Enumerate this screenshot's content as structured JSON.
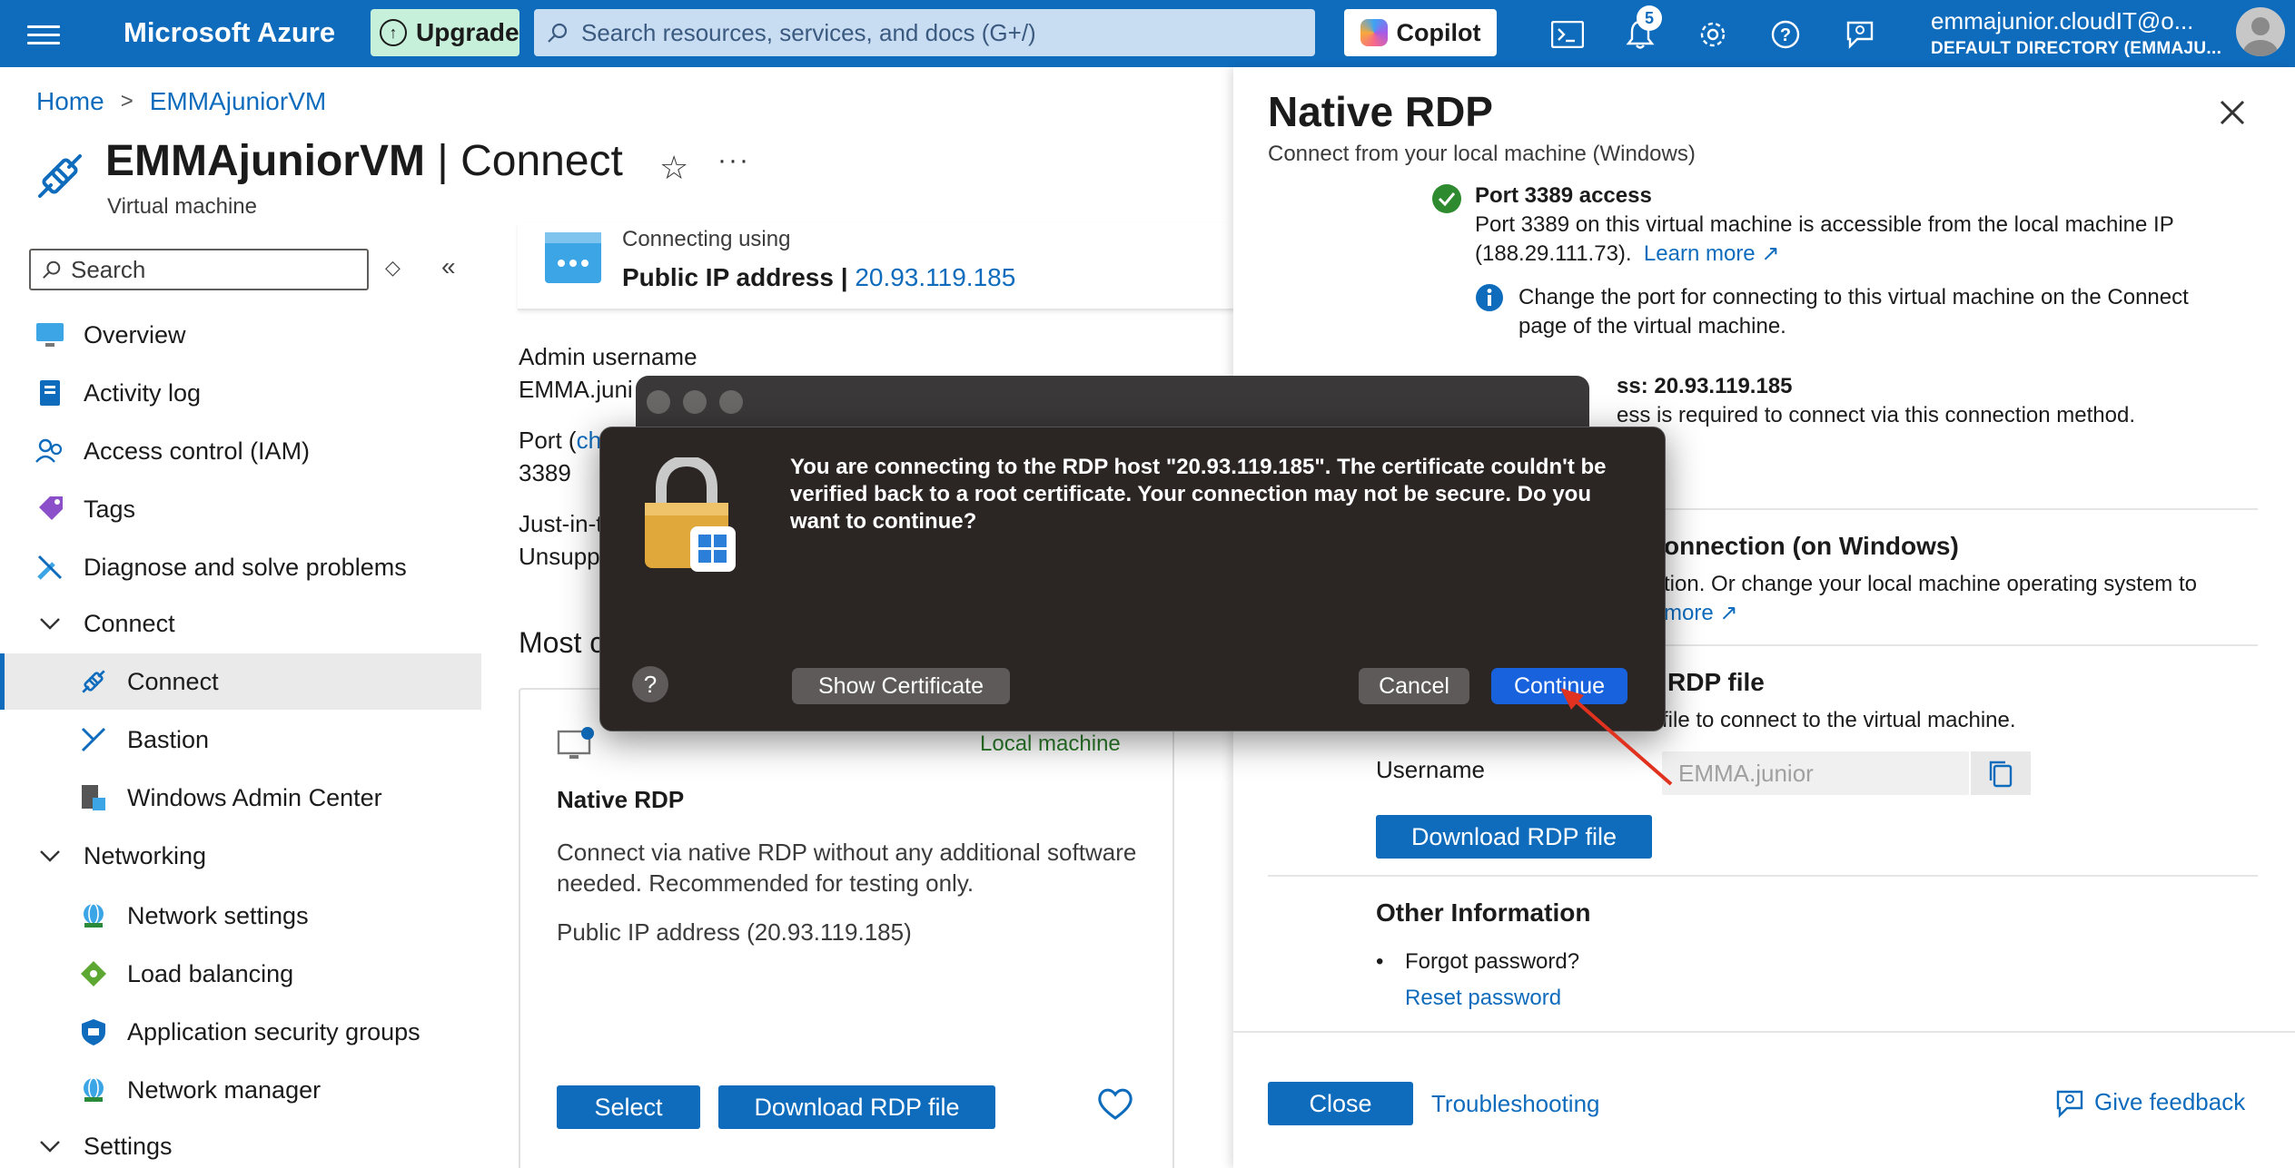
{
  "topbar": {
    "brand": "Microsoft Azure",
    "upgrade_label": "Upgrade",
    "search_placeholder": "Search resources, services, and docs (G+/)",
    "copilot_label": "Copilot",
    "notification_count": "5",
    "account_email": "emmajunior.cloudIT@o...",
    "account_directory": "DEFAULT DIRECTORY (EMMAJU..."
  },
  "breadcrumb": {
    "home": "Home",
    "current": "EMMAjuniorVM"
  },
  "header": {
    "title_main": "EMMAjuniorVM",
    "title_sep": " | ",
    "title_section": "Connect",
    "subtitle": "Virtual machine"
  },
  "sidebar": {
    "search_placeholder": "Search",
    "items": [
      {
        "label": "Overview"
      },
      {
        "label": "Activity log"
      },
      {
        "label": "Access control (IAM)"
      },
      {
        "label": "Tags"
      },
      {
        "label": "Diagnose and solve problems"
      },
      {
        "label": "Connect"
      },
      {
        "label": "Connect"
      },
      {
        "label": "Bastion"
      },
      {
        "label": "Windows Admin Center"
      },
      {
        "label": "Networking"
      },
      {
        "label": "Network settings"
      },
      {
        "label": "Load balancing"
      },
      {
        "label": "Application security groups"
      },
      {
        "label": "Network manager"
      },
      {
        "label": "Settings"
      }
    ]
  },
  "main": {
    "connecting_using": "Connecting using",
    "ip_label": "Public IP address | ",
    "ip_value": "20.93.119.185",
    "admin_username_label": "Admin username",
    "admin_username_value": "EMMA.juni",
    "port_label": "Port (",
    "port_link": "ch",
    "port_value": "3389",
    "jit_label": "Just-in-t",
    "jit_value": "Unsupp",
    "most_heading": "Most c",
    "card": {
      "badge": "Local machine",
      "title": "Native RDP",
      "desc": "Connect via native RDP without any additional software needed. Recommended for testing only.",
      "public_ip": "Public IP address (20.93.119.185)",
      "select_label": "Select",
      "download_label": "Download RDP file"
    }
  },
  "panel": {
    "title": "Native RDP",
    "subtitle": "Connect from your local machine (Windows)",
    "port_title": "Port 3389 access",
    "port_desc1": "Port 3389 on this virtual machine is accessible from the local machine IP",
    "port_desc2": "(188.29.111.73).",
    "learn_more": "Learn more",
    "info_text1": "Change the port for connecting to this virtual machine on the Connect",
    "info_text2": "page of the virtual machine.",
    "ip_title": "ss: 20.93.119.185",
    "ip_desc": "ess is required to connect via this connection method.",
    "conn_title": "onnection (on Windows)",
    "conn_desc": "ction. Or change your local machine operating system to",
    "conn_more": "more",
    "rdp_title": "RDP file",
    "rdp_desc": "file to connect to the virtual machine.",
    "username_label": "Username",
    "username_value": "EMMA.junior",
    "download_label": "Download RDP file",
    "other_title": "Other Information",
    "forgot": "Forgot password?",
    "reset": "Reset password",
    "close_label": "Close",
    "troubleshoot": "Troubleshooting",
    "feedback": "Give feedback"
  },
  "dialog": {
    "message": "You are connecting to the RDP host \"20.93.119.185\". The certificate couldn't be verified back to a root certificate. Your connection may not be secure. Do you want to continue?",
    "help": "?",
    "show_cert": "Show Certificate",
    "cancel": "Cancel",
    "continue": "Continue"
  }
}
